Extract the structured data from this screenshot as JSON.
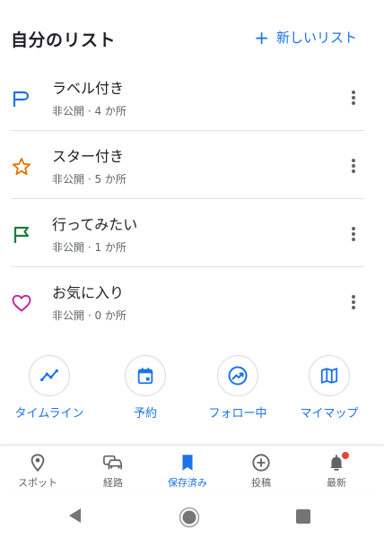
{
  "header": {
    "title": "自分のリスト",
    "new_list_plus": "+",
    "new_list_label": "新しいリスト"
  },
  "lists": [
    {
      "title": "ラベル付き",
      "subtitle": "非公開 · 4 か所",
      "icon": "label-flag-icon",
      "icon_color": "#1a73e8"
    },
    {
      "title": "スター付き",
      "subtitle": "非公開 · 5 か所",
      "icon": "star-icon",
      "icon_color": "#e37400"
    },
    {
      "title": "行ってみたい",
      "subtitle": "非公開 · 1 か所",
      "icon": "flag-icon",
      "icon_color": "#188038"
    },
    {
      "title": "お気に入り",
      "subtitle": "非公開 · 0 か所",
      "icon": "heart-icon",
      "icon_color": "#c5219f"
    }
  ],
  "shortcuts": [
    {
      "label": "タイムライン",
      "icon": "timeline-icon"
    },
    {
      "label": "予約",
      "icon": "calendar-icon"
    },
    {
      "label": "フォロー中",
      "icon": "trending-icon"
    },
    {
      "label": "マイマップ",
      "icon": "map-icon"
    }
  ],
  "bottom_nav": [
    {
      "label": "スポット",
      "icon": "location-pin-icon",
      "active": false
    },
    {
      "label": "経路",
      "icon": "car-icon",
      "active": false
    },
    {
      "label": "保存済み",
      "icon": "bookmark-icon",
      "active": true
    },
    {
      "label": "投稿",
      "icon": "add-circle-icon",
      "active": false
    },
    {
      "label": "最新",
      "icon": "bell-icon",
      "active": false,
      "badge": true
    }
  ],
  "colors": {
    "accent": "#1a73e8",
    "text_primary": "#202124",
    "text_secondary": "#5f6368",
    "badge": "#ea4335"
  }
}
